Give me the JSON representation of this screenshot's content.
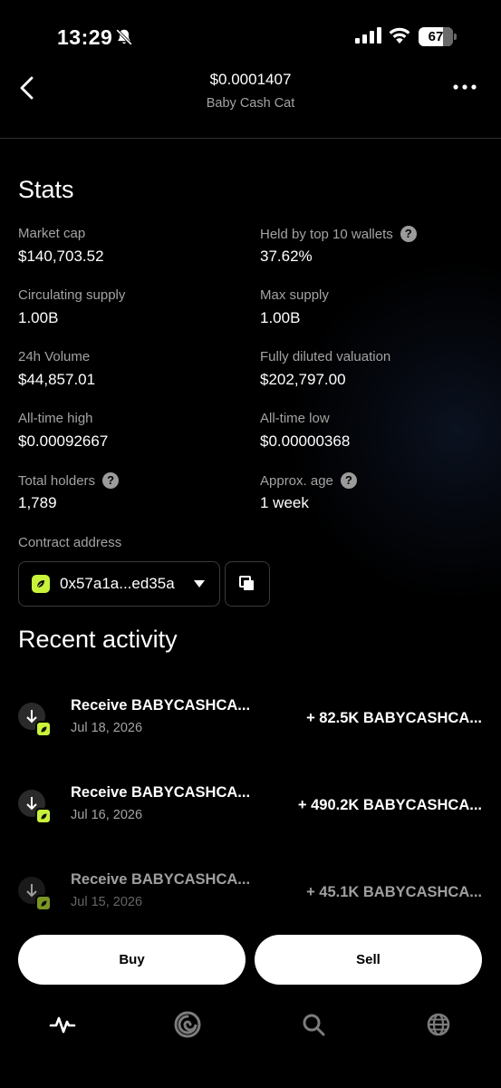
{
  "status_bar": {
    "time": "13:29",
    "battery": "67"
  },
  "header": {
    "price": "$0.0001407",
    "token_name": "Baby Cash Cat"
  },
  "stats": {
    "title": "Stats",
    "items": [
      {
        "label": "Market cap",
        "value": "$140,703.52",
        "help": false
      },
      {
        "label": "Held by top 10 wallets",
        "value": "37.62%",
        "help": true
      },
      {
        "label": "Circulating supply",
        "value": "1.00B",
        "help": false
      },
      {
        "label": "Max supply",
        "value": "1.00B",
        "help": false
      },
      {
        "label": "24h Volume",
        "value": "$44,857.01",
        "help": false
      },
      {
        "label": "Fully diluted valuation",
        "value": "$202,797.00",
        "help": false
      },
      {
        "label": "All-time high",
        "value": "$0.00092667",
        "help": false
      },
      {
        "label": "All-time low",
        "value": "$0.00000368",
        "help": false
      },
      {
        "label": "Total holders",
        "value": "1,789",
        "help": true
      },
      {
        "label": "Approx. age",
        "value": "1 week",
        "help": true
      }
    ]
  },
  "contract": {
    "label": "Contract address",
    "address": "0x57a1a...ed35a"
  },
  "activity": {
    "title": "Recent activity",
    "items": [
      {
        "title": "Receive BABYCASHCA...",
        "date": "Jul 18, 2026",
        "amount": "+ 82.5K BABYCASHCA..."
      },
      {
        "title": "Receive BABYCASHCA...",
        "date": "Jul 16, 2026",
        "amount": "+ 490.2K BABYCASHCA..."
      },
      {
        "title": "Receive BABYCASHCA...",
        "date": "Jul 15, 2026",
        "amount": "+ 45.1K BABYCASHCA..."
      }
    ]
  },
  "actions": {
    "buy": "Buy",
    "sell": "Sell"
  },
  "tabs": [
    {
      "icon": "activity-icon"
    },
    {
      "icon": "portfolio-swirl-icon"
    },
    {
      "icon": "search-icon"
    },
    {
      "icon": "globe-icon"
    }
  ],
  "colors": {
    "accent": "#c9f23a",
    "muted_text": "#a3a3a3",
    "background": "#000000"
  }
}
